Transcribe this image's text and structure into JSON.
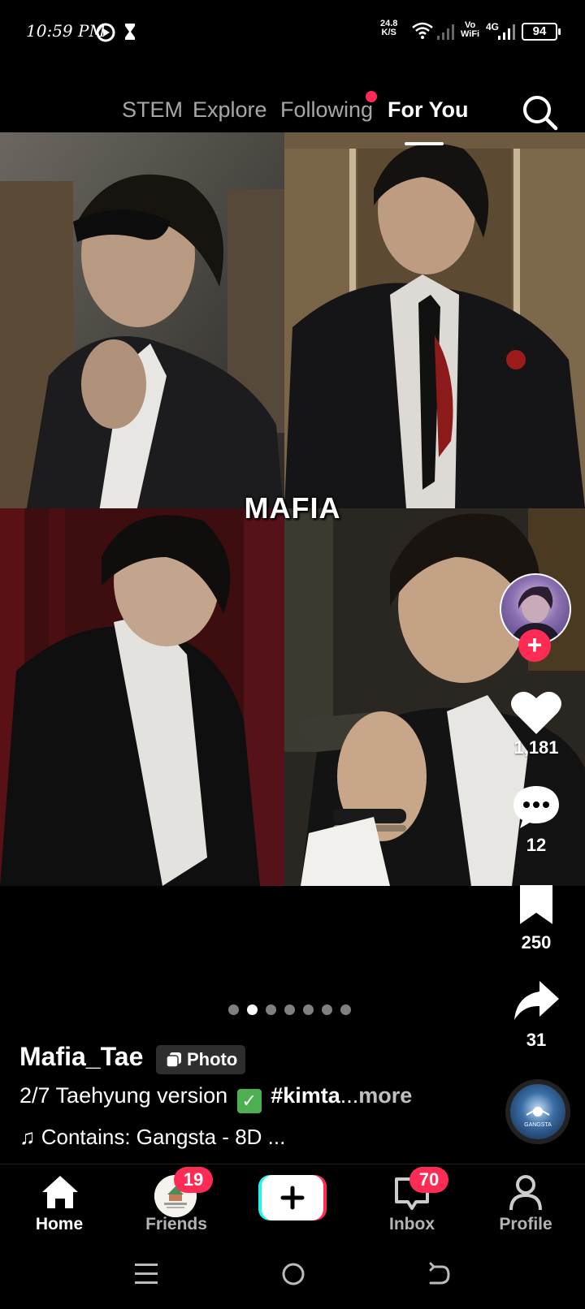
{
  "status_bar": {
    "time": "10:59 PM",
    "net_speed_value": "24.8",
    "net_speed_unit": "K/S",
    "vowifi_top": "Vo",
    "vowifi_bottom": "WiFi",
    "network": "4G",
    "battery": "94"
  },
  "top_tabs": {
    "items": [
      {
        "label": "STEM"
      },
      {
        "label": "Explore"
      },
      {
        "label": "Following"
      },
      {
        "label": "For You"
      }
    ],
    "active_index": 3
  },
  "post": {
    "overlay_title": "MAFIA",
    "username": "Mafia_Tae",
    "type_badge": "Photo",
    "caption_text": "2/7 Taehyung version",
    "caption_hashtag": "#kimta",
    "caption_ellipsis": "...",
    "caption_more": "more",
    "music": "Contains: Gangsta - 8D ...",
    "music_disc_label": "GANGSTA",
    "carousel_count": 7,
    "carousel_active": 1
  },
  "actions": {
    "likes": "1,181",
    "comments": "12",
    "saves": "250",
    "shares": "31"
  },
  "bottom_nav": {
    "items": [
      {
        "label": "Home"
      },
      {
        "label": "Friends",
        "badge": "19"
      },
      {
        "label": "Create"
      },
      {
        "label": "Inbox",
        "badge": "70"
      },
      {
        "label": "Profile"
      }
    ]
  },
  "colors": {
    "accent": "#fe2c55",
    "background": "#000000",
    "check_green": "#4caf50"
  }
}
